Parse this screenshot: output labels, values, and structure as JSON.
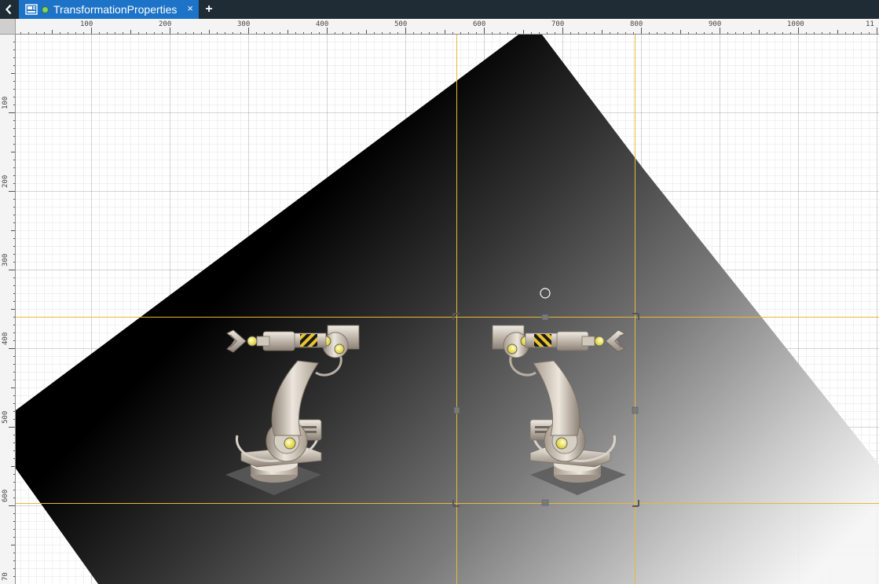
{
  "window": {
    "tab_title": "TransformationProperties",
    "tab_status": "modified-indicator",
    "close_label": "×",
    "add_label": "+"
  },
  "icons": {
    "back": "chevron-left-icon",
    "document": "display-document-icon",
    "close": "close-icon",
    "add": "plus-icon"
  },
  "rulers": {
    "horizontal_labels": [
      "100",
      "200",
      "300",
      "400",
      "500",
      "600",
      "700",
      "800",
      "900",
      "1000",
      "11"
    ],
    "vertical_labels": [
      "100",
      "200",
      "300",
      "400",
      "500",
      "600",
      "70"
    ]
  },
  "canvas": {
    "objects": [
      "gradient-polygon",
      "robot-arm-left",
      "robot-arm-right-mirrored"
    ],
    "selection": "robot-arm-right-mirrored"
  },
  "colors": {
    "titlebar": "#1f2c36",
    "active_tab": "#1d73c7",
    "status_dot": "#7fd36b",
    "guide": "#e6b93a",
    "grid": "#e0e0e0"
  }
}
